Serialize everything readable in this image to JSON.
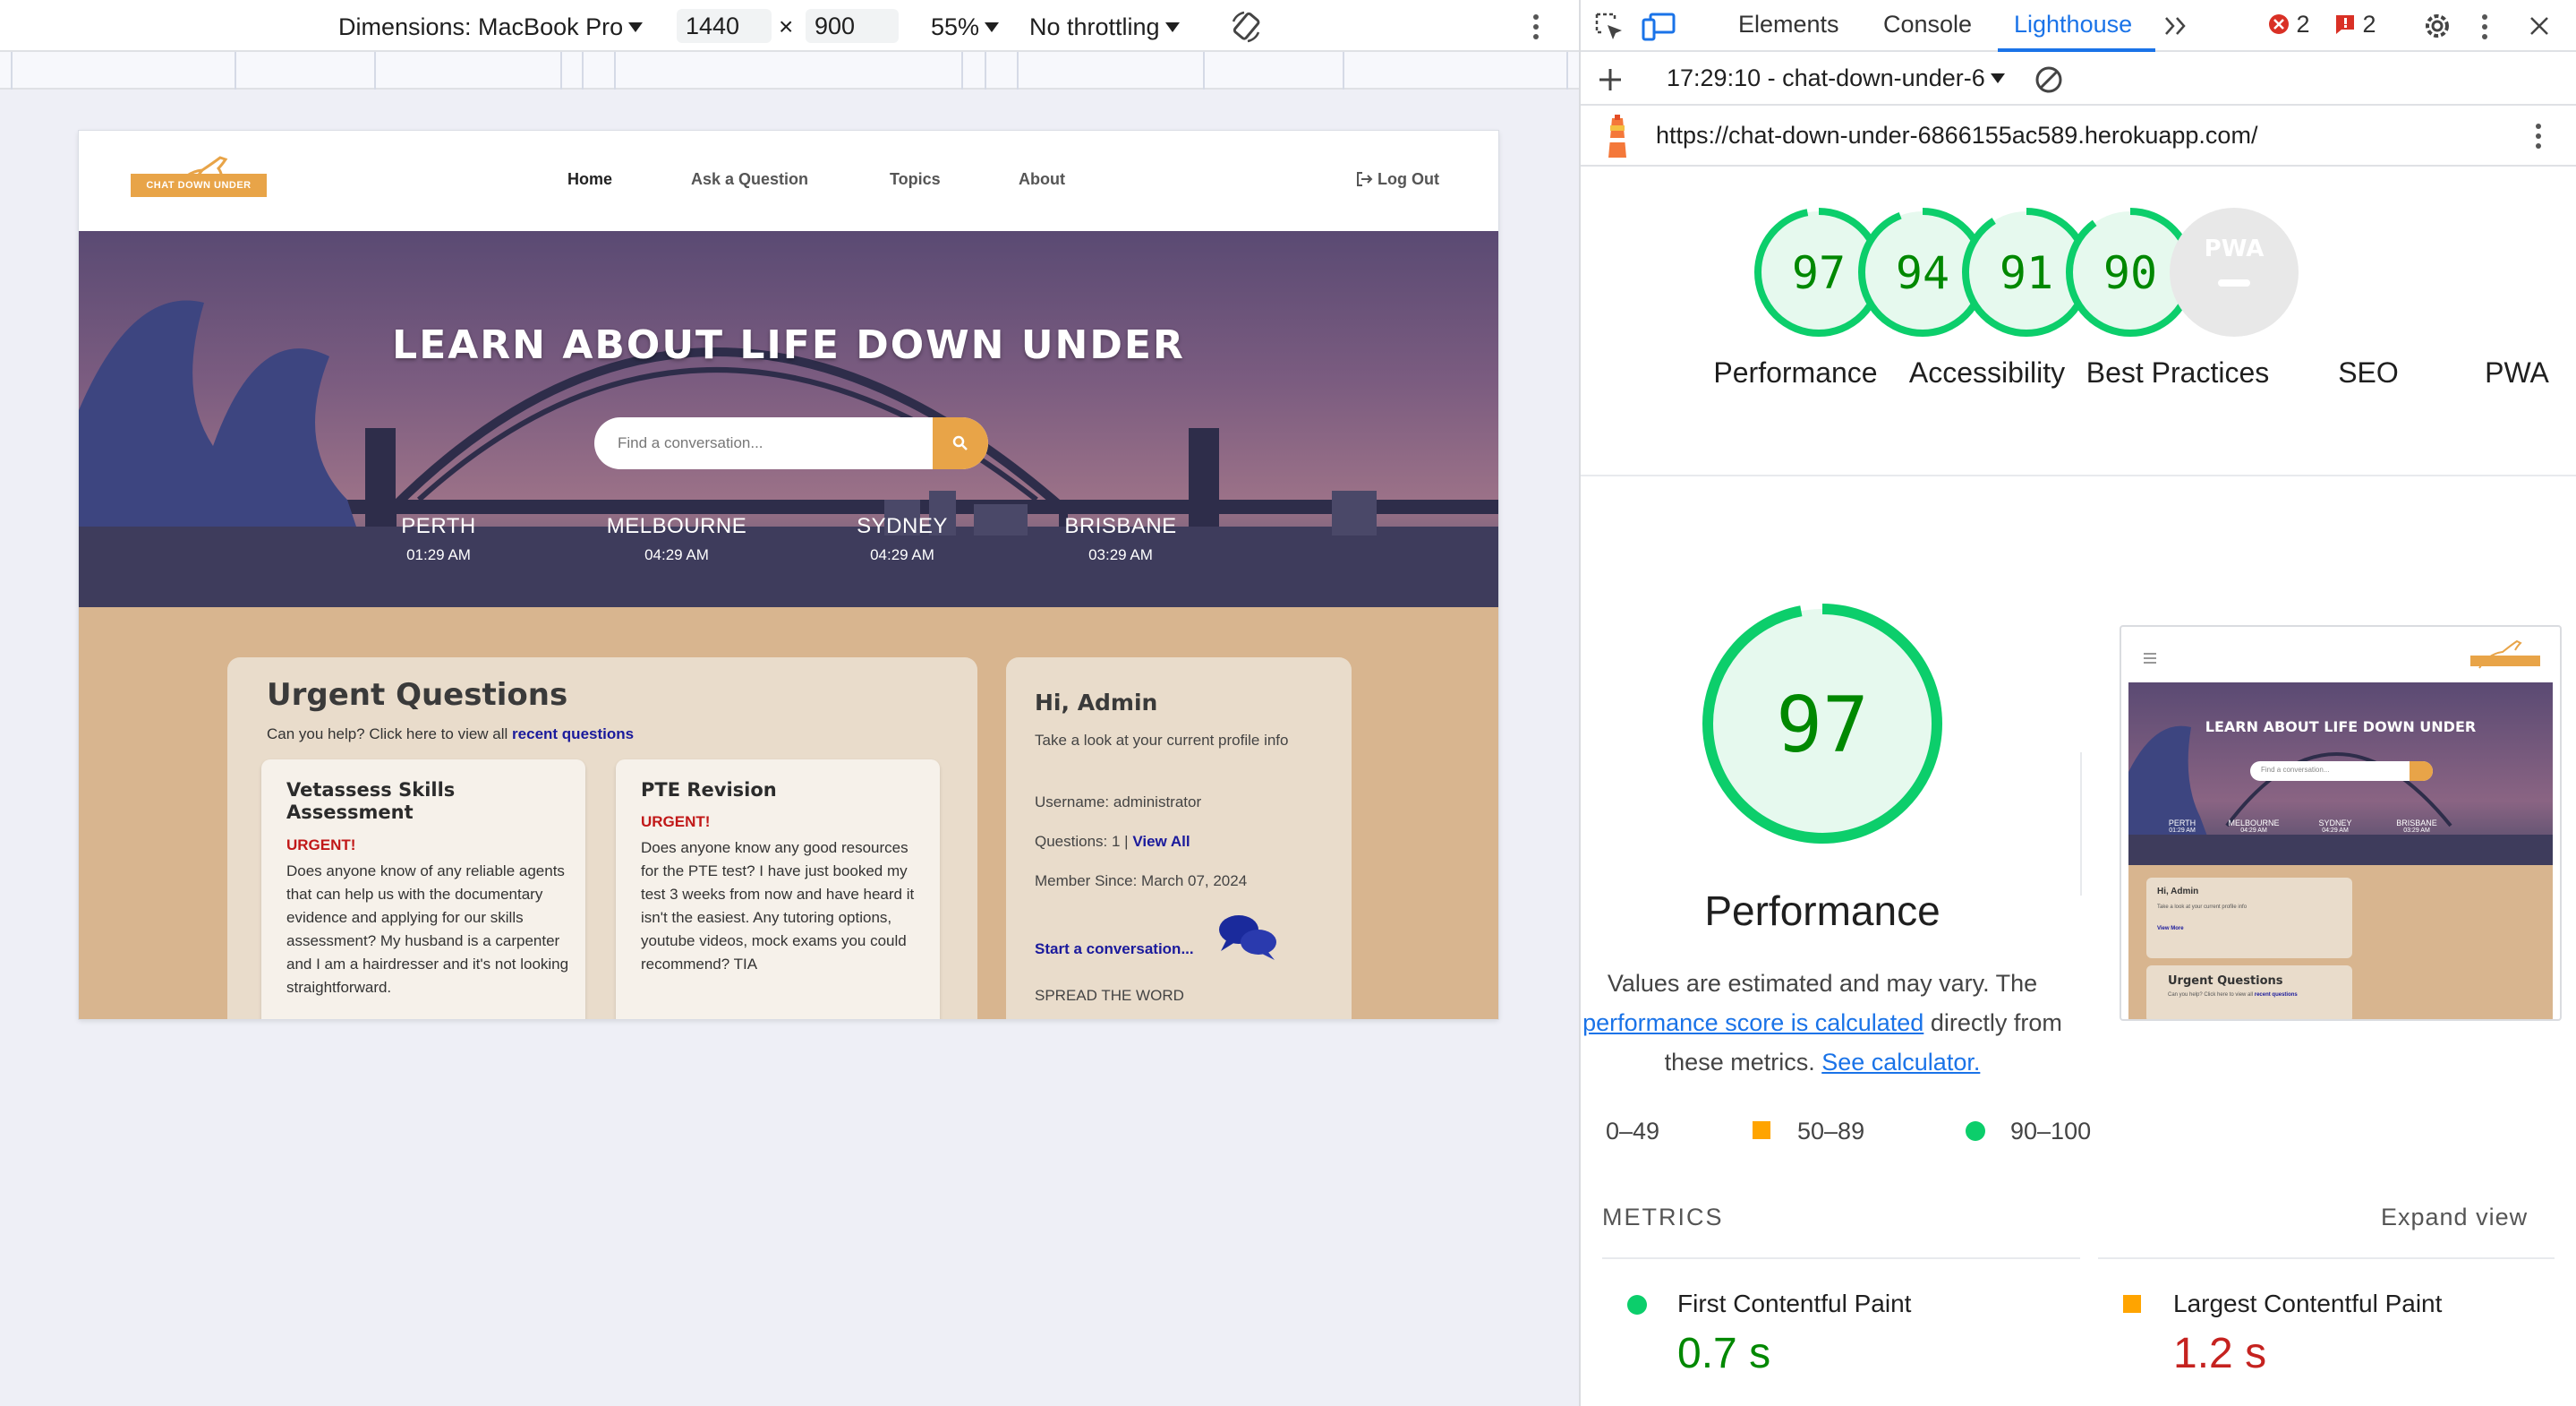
{
  "device_toolbar": {
    "dimensions_label": "Dimensions: MacBook Pro",
    "width": "1440",
    "times": "×",
    "height": "900",
    "zoom": "55%",
    "throttling": "No throttling"
  },
  "site": {
    "logo_text": "CHAT DOWN UNDER",
    "nav": [
      "Home",
      "Ask a Question",
      "Topics",
      "About"
    ],
    "logout": "Log Out",
    "hero_title": "LEARN ABOUT LIFE DOWN UNDER",
    "search_placeholder": "Find a conversation...",
    "cities": [
      {
        "name": "PERTH",
        "time": "01:29 AM"
      },
      {
        "name": "MELBOURNE",
        "time": "04:29 AM"
      },
      {
        "name": "SYDNEY",
        "time": "04:29 AM"
      },
      {
        "name": "BRISBANE",
        "time": "03:29 AM"
      }
    ],
    "urgent": {
      "title": "Urgent Questions",
      "subtitle": "Can you help? Click here to view all",
      "subtitle_link": "recent questions",
      "questions": [
        {
          "title": "Vetassess Skills Assessment",
          "tag": "URGENT!",
          "body": "Does anyone know of any reliable agents that can help us with the documentary evidence and applying for our skills assessment? My husband is a carpenter and I am a hairdresser and it's not looking straightforward."
        },
        {
          "title": "PTE Revision",
          "tag": "URGENT!",
          "body": "Does anyone know any good resources for the PTE test? I have just booked my test 3 weeks from now and have heard it isn't the easiest. Any tutoring options, youtube videos, mock exams you could recommend? TIA"
        }
      ]
    },
    "profile": {
      "greeting": "Hi, Admin",
      "intro": "Take a look at your current profile info",
      "username": "Username: administrator",
      "questions": "Questions: 1 |",
      "view_all": "View All",
      "member_since": "Member Since: March 07, 2024",
      "start": "Start a conversation...",
      "spread": "SPREAD THE WORD"
    }
  },
  "devtools": {
    "tabs": [
      "Elements",
      "Console",
      "Lighthouse"
    ],
    "active_tab": "Lighthouse",
    "error_count": "2",
    "issue_count": "2",
    "report_label": "17:29:10 - chat-down-under-6",
    "url": "https://chat-down-under-6866155ac589.herokuapp.com/",
    "scores": [
      {
        "label": "Performance",
        "value": 97
      },
      {
        "label": "Accessibility",
        "value": 94
      },
      {
        "label": "Best Practices",
        "value": 91
      },
      {
        "label": "SEO",
        "value": 90
      },
      {
        "label": "PWA",
        "value": null
      }
    ],
    "pwa_badge": "PWA",
    "big_score": {
      "label": "Performance",
      "value": 97
    },
    "estimate_text_1": "Values are estimated and may vary. The",
    "estimate_link": "performance score is calculated",
    "estimate_text_2": "directly from",
    "estimate_text_3": "these metrics.",
    "calculator_link": "See calculator.",
    "legend": [
      "0–49",
      "50–89",
      "90–100"
    ],
    "metrics_title": "METRICS",
    "expand_view": "Expand view",
    "metrics": [
      {
        "label": "First Contentful Paint",
        "value": "0.7 s"
      },
      {
        "label": "Largest Contentful Paint",
        "value": "1.2 s"
      }
    ],
    "thumbnail": {
      "hero_title": "LEARN ABOUT LIFE DOWN UNDER",
      "search_placeholder": "Find a conversation...",
      "cities": [
        "PERTH",
        "MELBOURNE",
        "SYDNEY",
        "BRISBANE"
      ],
      "times": [
        "01:29 AM",
        "04:29 AM",
        "04:29 AM",
        "03:29 AM"
      ],
      "greeting": "Hi, Admin",
      "intro": "Take a look at your current profile info",
      "view_more": "View More",
      "urgent_title": "Urgent Questions",
      "urgent_subtitle": "Can you help? Click here to view all",
      "urgent_link": "recent questions"
    },
    "colors": {
      "good": "#0cce6b",
      "good_text": "#008800",
      "average": "#ffa400",
      "poor_text": "#c5221f",
      "accent": "#1a73e8"
    }
  }
}
